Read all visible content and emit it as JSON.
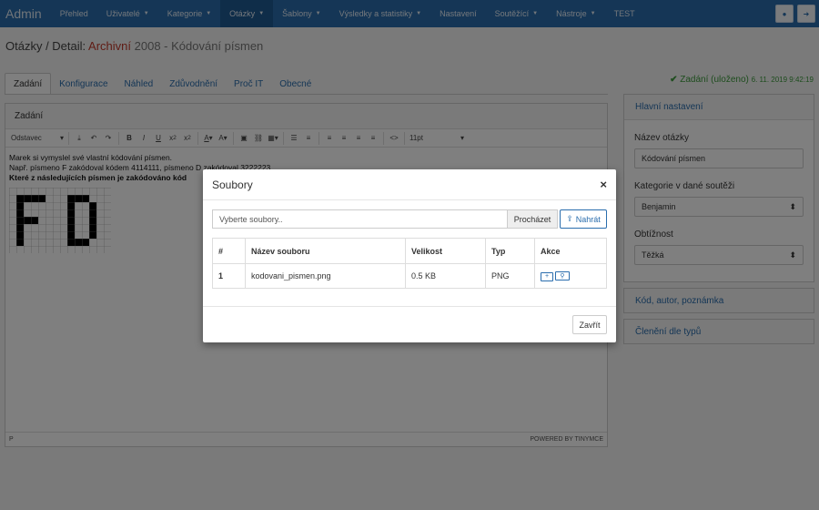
{
  "navbar": {
    "brand": "Admin",
    "items": [
      {
        "label": "Přehled",
        "caret": false
      },
      {
        "label": "Uživatelé",
        "caret": true
      },
      {
        "label": "Kategorie",
        "caret": true
      },
      {
        "label": "Otázky",
        "caret": true,
        "active": true
      },
      {
        "label": "Šablony",
        "caret": true
      },
      {
        "label": "Výsledky a statistiky",
        "caret": true
      },
      {
        "label": "Nastavení",
        "caret": false
      },
      {
        "label": "Soutěžící",
        "caret": true
      },
      {
        "label": "Nástroje",
        "caret": true
      },
      {
        "label": "TEST",
        "caret": false
      }
    ],
    "user_icon": "user-icon",
    "logout_icon": "sign-out-icon"
  },
  "page": {
    "title_prefix": "Otázky / Detail:",
    "title_archived": "Archivní",
    "title_rest": "2008 - Kódování písmen"
  },
  "tabs": [
    "Zadání",
    "Konfigurace",
    "Náhled",
    "Zdůvodnění",
    "Proč IT",
    "Obecné"
  ],
  "saved": {
    "check": "✔",
    "label": "Zadání (uloženo)",
    "timestamp": "6. 11. 2019 9:42:19"
  },
  "editor": {
    "heading": "Zadání",
    "format_select": "Odstavec",
    "size_select": "11pt",
    "line1": "Marek si vymyslel své vlastní kódování písmen.",
    "line2": "Např. písmeno F zakódoval kódem 4114111, písmeno D zakódoval 3222223.",
    "line3": "Které z následujících písmen je zakódováno kód",
    "status_path": "P",
    "powered": "POWERED BY TINYMCE"
  },
  "right_panel": {
    "heading": "Hlavní nastavení",
    "name_label": "Název otázky",
    "name_value": "Kódování písmen",
    "category_label": "Kategorie v dané soutěži",
    "category_value": "Benjamin",
    "difficulty_label": "Obtížnost",
    "difficulty_value": "Těžká",
    "panel2": "Kód, autor, poznámka",
    "panel3": "Členění dle typů"
  },
  "modal": {
    "title": "Soubory",
    "close_symbol": "×",
    "file_placeholder": "Vyberte soubory..",
    "browse": "Procházet",
    "upload": "Nahrát",
    "headers": [
      "#",
      "Název souboru",
      "Velikost",
      "Typ",
      "Akce"
    ],
    "rows": [
      {
        "num": "1",
        "name": "kodovani_pismen.png",
        "size": "0.5 KB",
        "type": "PNG"
      }
    ],
    "footer_close": "Zavřít"
  },
  "colors": {
    "primary": "#2a6dad",
    "archived": "#c0392b",
    "saved": "#3c9a3c"
  }
}
